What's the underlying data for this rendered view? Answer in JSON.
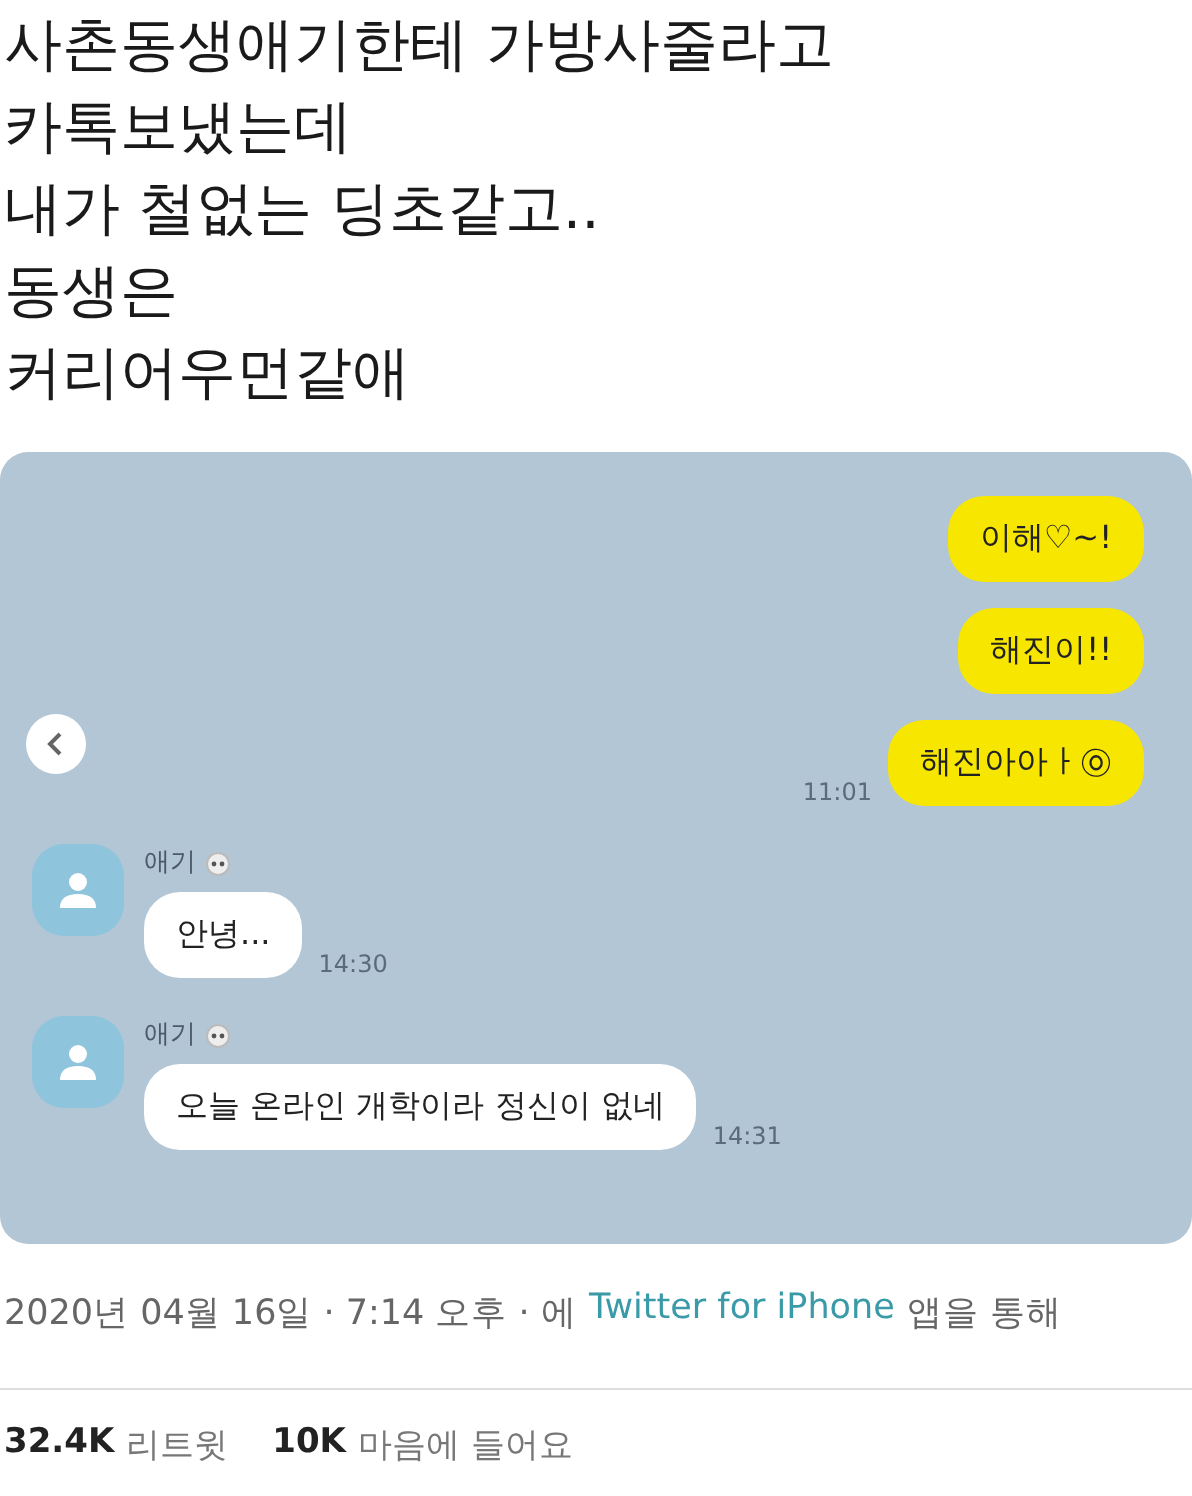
{
  "tweet_text": [
    "사촌동생애기한테 가방사줄라고",
    "카톡보냈는데",
    "내가 철없는 딩초같고..",
    "동생은",
    "커리어우먼같애"
  ],
  "chat": {
    "messages": [
      {
        "kind": "sent",
        "text": "이해♡~!"
      },
      {
        "kind": "sent",
        "text": "해진이!!"
      },
      {
        "kind": "sent",
        "text": "해진아아ㅏ㉧",
        "time": "11:01"
      },
      {
        "kind": "received",
        "sender": "애기",
        "text": "안녕...",
        "time": "14:30"
      },
      {
        "kind": "received",
        "sender": "애기",
        "text": "오늘 온라인 개학이라 정신이 없네",
        "time": "14:31"
      }
    ]
  },
  "meta": {
    "date": "2020년 04월 16일 · 7:14 오후 · 에",
    "source_link": "Twitter for iPhone",
    "suffix": "앱을 통해"
  },
  "stats": [
    {
      "count": "32.4K",
      "label": "리트윗"
    },
    {
      "count": "10K",
      "label": "마음에 들어요"
    }
  ]
}
